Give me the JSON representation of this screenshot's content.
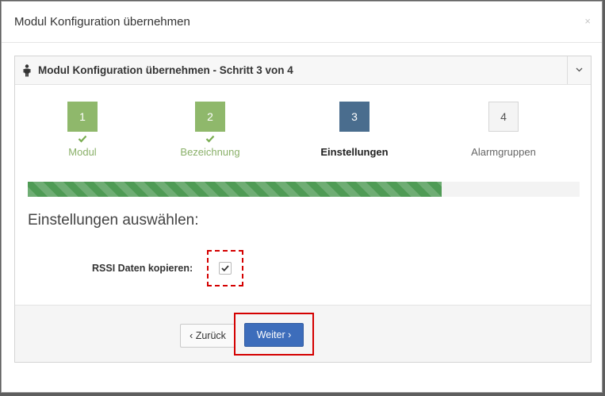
{
  "modal": {
    "title": "Modul Konfiguration übernehmen",
    "close_glyph": "×"
  },
  "panel": {
    "icon": "person-icon",
    "title": "Modul Konfiguration übernehmen - Schritt 3 von 4",
    "toggle_icon": "chevron-down-icon"
  },
  "wizard": {
    "steps": [
      {
        "number": "1",
        "label": "Modul",
        "state": "done"
      },
      {
        "number": "2",
        "label": "Bezeichnung",
        "state": "done"
      },
      {
        "number": "3",
        "label": "Einstellungen",
        "state": "active"
      },
      {
        "number": "4",
        "label": "Alarmgruppen",
        "state": "todo"
      }
    ],
    "progress_fraction": 0.75
  },
  "settings": {
    "heading": "Einstellungen auswählen:",
    "rssi_label": "RSSI Daten kopieren:",
    "rssi_checked": true
  },
  "footer": {
    "back_label": "‹ Zurück",
    "next_label": "Weiter ›"
  },
  "colors": {
    "step_done": "#8fb86b",
    "step_active": "#4a6d8e",
    "progress": "#4f9b55",
    "primary_button": "#3d6dbb",
    "highlight": "#d40000"
  }
}
